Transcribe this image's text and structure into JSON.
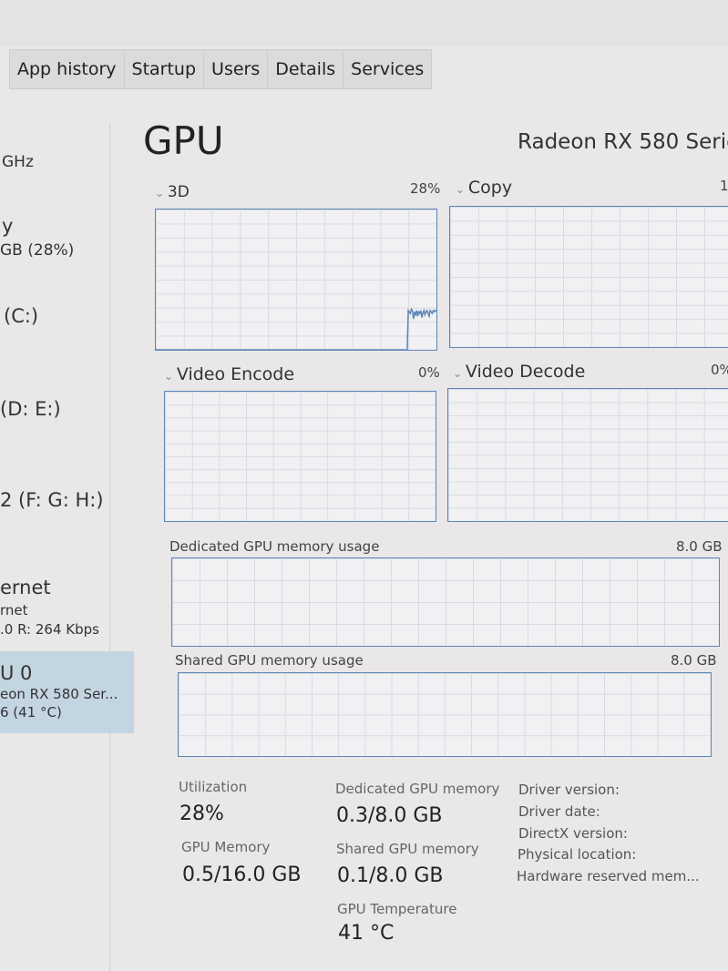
{
  "tabs": [
    "App history",
    "Startup",
    "Users",
    "Details",
    "Services"
  ],
  "sidebar": {
    "cpu_speed": "GHz",
    "memory_title": "y",
    "memory_value": "GB (28%)",
    "disk0": "(C:)",
    "disk1": "(D: E:)",
    "disk2": "2 (F: G: H:)",
    "ethernet_title": "ernet",
    "ethernet_sub": "rnet",
    "ethernet_value": ".0 R: 264 Kbps",
    "gpu_title": "U 0",
    "gpu_name": "eon RX 580 Ser...",
    "gpu_value": "6 (41 °C)"
  },
  "header": {
    "title": "GPU",
    "device": "Radeon RX 580 Serie"
  },
  "engines": [
    {
      "name": "3D",
      "value": "28%",
      "history": [
        0,
        0,
        0,
        0,
        0,
        0,
        0,
        0,
        0,
        0,
        0,
        0,
        0,
        0,
        0,
        0,
        0,
        0,
        0,
        0,
        0,
        0,
        0,
        0,
        0,
        0,
        0,
        0,
        0,
        0,
        0,
        0,
        0,
        0,
        0,
        0,
        0,
        0,
        0,
        0,
        0,
        0,
        0,
        0,
        0,
        0,
        0,
        0,
        0,
        0,
        0,
        0,
        0,
        0,
        0,
        0,
        0,
        0,
        0,
        0,
        0,
        0,
        0,
        0,
        0,
        0,
        0,
        0,
        0,
        0,
        0,
        0,
        0,
        0,
        0,
        0,
        0,
        0,
        0,
        0,
        0,
        0,
        0,
        0,
        0,
        0,
        0,
        0,
        0,
        0,
        0,
        0,
        0,
        0,
        0,
        0,
        0,
        0,
        0,
        0,
        0,
        0,
        0,
        0,
        0,
        0,
        0,
        0,
        0,
        0,
        0,
        0,
        0,
        0,
        0,
        0,
        0,
        0,
        0,
        0,
        0,
        0,
        0,
        0,
        0,
        0,
        0,
        0,
        0,
        0,
        0,
        0,
        0,
        0,
        0,
        0,
        0,
        0,
        0,
        0,
        0,
        0,
        0,
        0,
        0,
        0,
        0,
        0,
        0,
        0,
        0,
        0,
        0,
        0,
        0,
        0,
        0,
        0,
        0,
        0,
        0,
        0,
        0,
        0,
        0,
        0,
        0,
        0,
        0,
        0,
        0,
        0,
        0,
        0,
        0,
        0,
        0,
        0,
        0,
        0,
        0,
        0,
        0,
        0,
        0,
        0,
        0,
        0,
        0,
        0,
        0,
        0,
        0,
        0,
        0,
        0,
        0,
        0,
        0,
        0,
        0,
        0,
        0,
        0,
        0,
        0,
        0,
        0,
        0,
        0,
        0,
        0,
        0,
        0,
        0,
        0,
        0,
        0,
        0,
        0,
        0,
        0,
        0,
        0,
        0,
        0,
        0,
        0,
        0,
        0,
        0,
        0,
        0,
        0,
        0,
        0,
        0,
        0,
        0,
        0,
        0,
        0,
        28,
        27,
        26,
        29,
        28,
        22,
        27,
        25,
        28,
        24,
        27,
        26,
        28,
        23,
        26,
        28,
        25,
        27,
        28,
        26,
        24,
        28,
        27,
        26,
        28,
        27,
        28,
        28
      ]
    },
    {
      "name": "Copy",
      "value": "1"
    },
    {
      "name": "Video Encode",
      "value": "0%"
    },
    {
      "name": "Video Decode",
      "value": "0%"
    }
  ],
  "dedicated_memory": {
    "label": "Dedicated GPU memory usage",
    "max": "8.0 GB"
  },
  "shared_memory": {
    "label": "Shared GPU memory usage",
    "max": "8.0 GB"
  },
  "stats": {
    "utilization_label": "Utilization",
    "utilization": "28%",
    "gpu_memory_label": "GPU Memory",
    "gpu_memory": "0.5/16.0 GB",
    "dedicated_label": "Dedicated GPU memory",
    "dedicated": "0.3/8.0 GB",
    "shared_label": "Shared GPU memory",
    "shared": "0.1/8.0 GB",
    "temp_label": "GPU Temperature",
    "temp": "41 °C"
  },
  "info": [
    "Driver version:",
    "Driver date:",
    "DirectX version:",
    "Physical location:",
    "Hardware reserved mem..."
  ],
  "colors": {
    "graph_line": "#5b87b8",
    "selected": "#c4d5e2"
  }
}
